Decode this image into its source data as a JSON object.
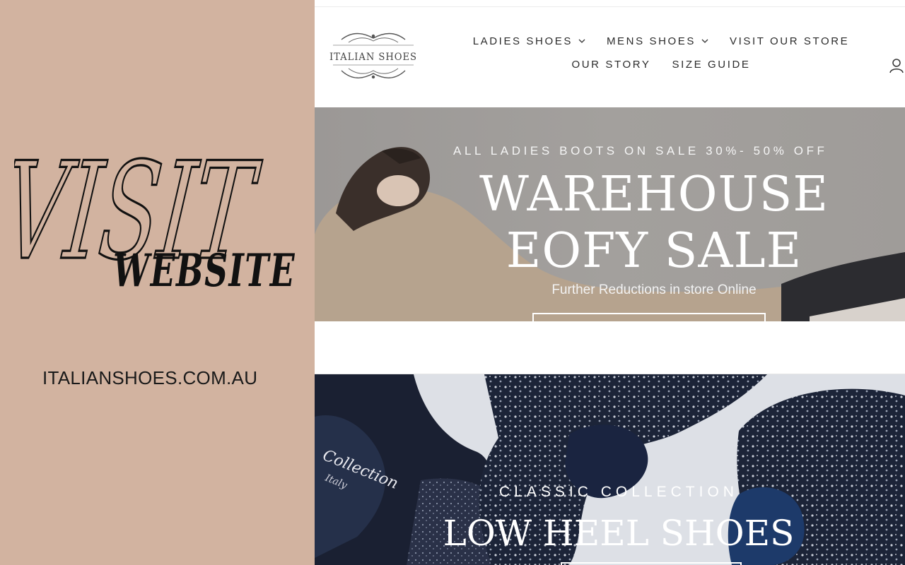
{
  "promo": {
    "visit_label": "VISIT",
    "website_label": "WEBSITE",
    "site_url": "ITALIANSHOES.COM.AU"
  },
  "header": {
    "logo_text": "ITALIAN SHOES",
    "nav": [
      {
        "label": "LADIES SHOES",
        "has_dropdown": true
      },
      {
        "label": "MENS SHOES",
        "has_dropdown": true
      },
      {
        "label": "VISIT OUR STORE",
        "has_dropdown": false
      },
      {
        "label": "OUR STORY",
        "has_dropdown": false
      },
      {
        "label": "SIZE GUIDE",
        "has_dropdown": false
      }
    ],
    "account_icon": "account-icon"
  },
  "hero1": {
    "kicker": "ALL LADIES BOOTS ON SALE 30%- 50% OFF",
    "title_line1": "WAREHOUSE",
    "title_line2": "EOFY SALE",
    "subtitle": "Further Reductions in store Online"
  },
  "hero2": {
    "kicker": "CLASSIC COLLECTION",
    "title": "LOW HEEL SHOES",
    "shoe_print": "Collection",
    "shoe_print2": "Italy"
  },
  "colors": {
    "panel_bg": "#d2b3a0",
    "hero1_bg": "#a09d9a",
    "hero2_bg": "#dde0e6",
    "shoe_navy": "#1c2438"
  }
}
